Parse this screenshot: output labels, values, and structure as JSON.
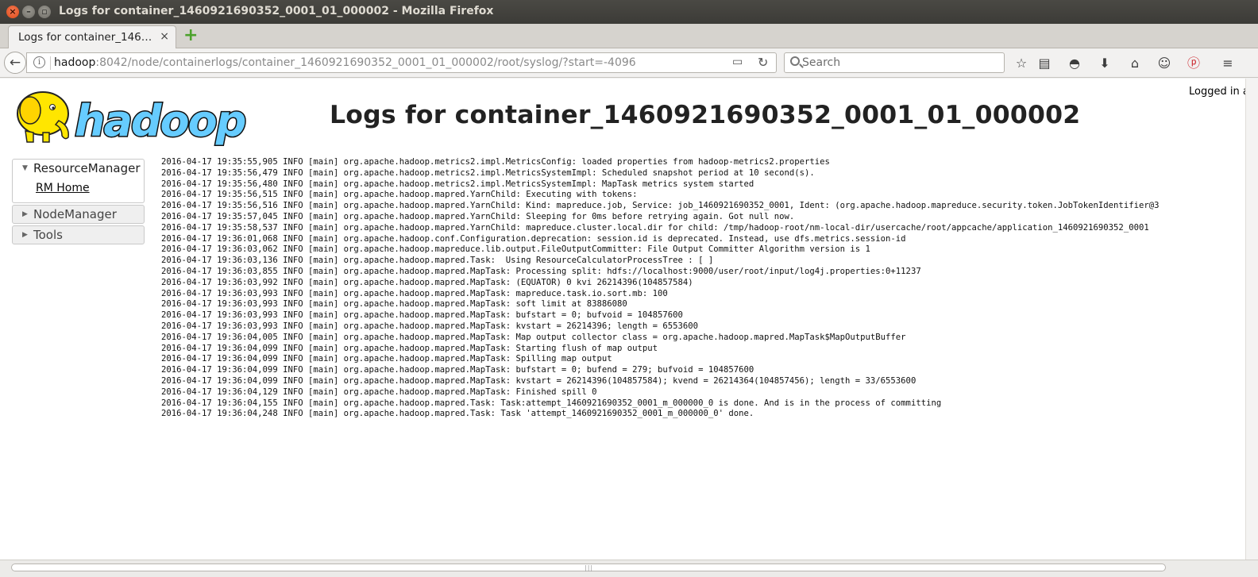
{
  "window": {
    "title": "Logs for container_1460921690352_0001_01_000002 - Mozilla Firefox"
  },
  "tab": {
    "title": "Logs for container_146…",
    "close_glyph": "×"
  },
  "toolbar": {
    "new_tab_glyph": "+",
    "back_glyph": "←",
    "url_host": "hadoop",
    "url_rest": ":8042/node/containerlogs/container_1460921690352_0001_01_000002/root/syslog/?start=-4096",
    "search_placeholder": "Search",
    "info_glyph": "i",
    "reader_glyph": "▭",
    "reload_glyph": "↻",
    "icons": [
      "bookmark-star-icon",
      "reading-list-icon",
      "pocket-icon",
      "download-icon",
      "home-icon",
      "smiley-icon",
      "pinterest-icon",
      "menu-icon"
    ],
    "icon_glyphs": {
      "star": "☆",
      "list": "▤",
      "pocket": "◓",
      "download": "⬇",
      "home": "⌂",
      "smiley": "☺",
      "pinterest": "ⓟ",
      "menu": "≡"
    }
  },
  "page": {
    "logged_in": "Logged in a",
    "title": "Logs for container_1460921690352_0001_01_000002",
    "logo_text": "hadoop"
  },
  "nav": {
    "sections": [
      {
        "label": "ResourceManager",
        "open": true,
        "triangle": "▼",
        "items": [
          {
            "label": "RM Home"
          }
        ]
      },
      {
        "label": "NodeManager",
        "open": false,
        "triangle": "▶"
      },
      {
        "label": "Tools",
        "open": false,
        "triangle": "▶"
      }
    ]
  },
  "log_lines": [
    "2016-04-17 19:35:55,905 INFO [main] org.apache.hadoop.metrics2.impl.MetricsConfig: loaded properties from hadoop-metrics2.properties",
    "2016-04-17 19:35:56,479 INFO [main] org.apache.hadoop.metrics2.impl.MetricsSystemImpl: Scheduled snapshot period at 10 second(s).",
    "2016-04-17 19:35:56,480 INFO [main] org.apache.hadoop.metrics2.impl.MetricsSystemImpl: MapTask metrics system started",
    "2016-04-17 19:35:56,515 INFO [main] org.apache.hadoop.mapred.YarnChild: Executing with tokens:",
    "2016-04-17 19:35:56,516 INFO [main] org.apache.hadoop.mapred.YarnChild: Kind: mapreduce.job, Service: job_1460921690352_0001, Ident: (org.apache.hadoop.mapreduce.security.token.JobTokenIdentifier@3",
    "2016-04-17 19:35:57,045 INFO [main] org.apache.hadoop.mapred.YarnChild: Sleeping for 0ms before retrying again. Got null now.",
    "2016-04-17 19:35:58,537 INFO [main] org.apache.hadoop.mapred.YarnChild: mapreduce.cluster.local.dir for child: /tmp/hadoop-root/nm-local-dir/usercache/root/appcache/application_1460921690352_0001",
    "2016-04-17 19:36:01,068 INFO [main] org.apache.hadoop.conf.Configuration.deprecation: session.id is deprecated. Instead, use dfs.metrics.session-id",
    "2016-04-17 19:36:03,062 INFO [main] org.apache.hadoop.mapreduce.lib.output.FileOutputCommitter: File Output Committer Algorithm version is 1",
    "2016-04-17 19:36:03,136 INFO [main] org.apache.hadoop.mapred.Task:  Using ResourceCalculatorProcessTree : [ ]",
    "2016-04-17 19:36:03,855 INFO [main] org.apache.hadoop.mapred.MapTask: Processing split: hdfs://localhost:9000/user/root/input/log4j.properties:0+11237",
    "2016-04-17 19:36:03,992 INFO [main] org.apache.hadoop.mapred.MapTask: (EQUATOR) 0 kvi 26214396(104857584)",
    "2016-04-17 19:36:03,993 INFO [main] org.apache.hadoop.mapred.MapTask: mapreduce.task.io.sort.mb: 100",
    "2016-04-17 19:36:03,993 INFO [main] org.apache.hadoop.mapred.MapTask: soft limit at 83886080",
    "2016-04-17 19:36:03,993 INFO [main] org.apache.hadoop.mapred.MapTask: bufstart = 0; bufvoid = 104857600",
    "2016-04-17 19:36:03,993 INFO [main] org.apache.hadoop.mapred.MapTask: kvstart = 26214396; length = 6553600",
    "2016-04-17 19:36:04,005 INFO [main] org.apache.hadoop.mapred.MapTask: Map output collector class = org.apache.hadoop.mapred.MapTask$MapOutputBuffer",
    "2016-04-17 19:36:04,099 INFO [main] org.apache.hadoop.mapred.MapTask: Starting flush of map output",
    "2016-04-17 19:36:04,099 INFO [main] org.apache.hadoop.mapred.MapTask: Spilling map output",
    "2016-04-17 19:36:04,099 INFO [main] org.apache.hadoop.mapred.MapTask: bufstart = 0; bufend = 279; bufvoid = 104857600",
    "2016-04-17 19:36:04,099 INFO [main] org.apache.hadoop.mapred.MapTask: kvstart = 26214396(104857584); kvend = 26214364(104857456); length = 33/6553600",
    "2016-04-17 19:36:04,129 INFO [main] org.apache.hadoop.mapred.MapTask: Finished spill 0",
    "2016-04-17 19:36:04,155 INFO [main] org.apache.hadoop.mapred.Task: Task:attempt_1460921690352_0001_m_000000_0 is done. And is in the process of committing",
    "2016-04-17 19:36:04,248 INFO [main] org.apache.hadoop.mapred.Task: Task 'attempt_1460921690352_0001_m_000000_0' done."
  ],
  "colors": {
    "titlebar": "#3c3b37",
    "close_button": "#df4a16",
    "logo_yellow": "#ffe600",
    "logo_blue": "#66ccff",
    "pinterest": "#cb2027"
  }
}
